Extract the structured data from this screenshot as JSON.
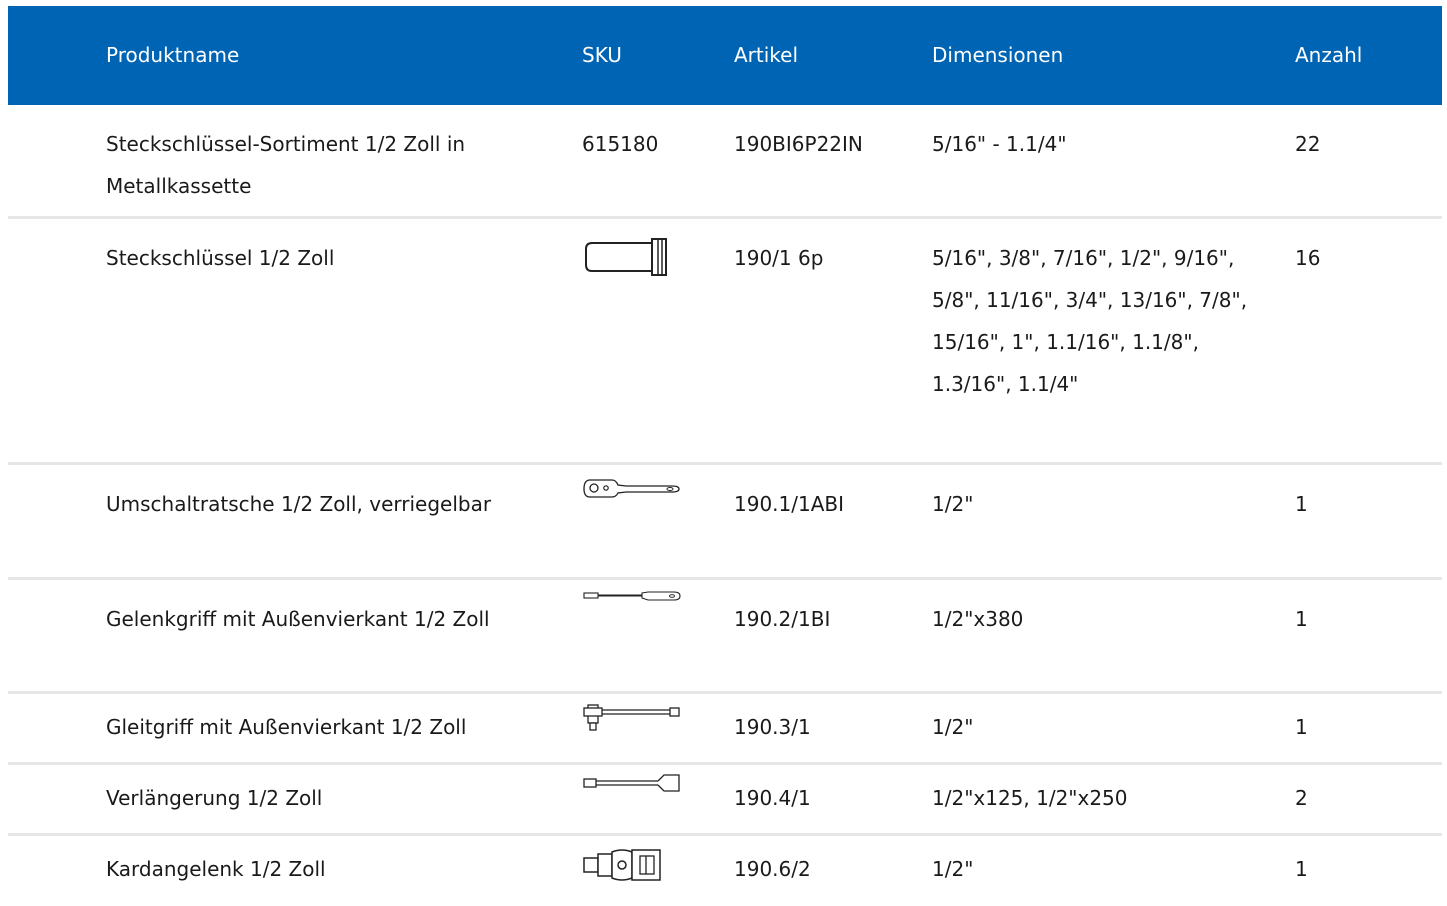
{
  "header": {
    "name": "Produktname",
    "sku": "SKU",
    "artikel": "Artikel",
    "dimensionen": "Dimensionen",
    "anzahl": "Anzahl"
  },
  "rows": [
    {
      "name": "Steckschlüssel-Sortiment 1/2 Zoll in Metallkassette",
      "sku": "615180",
      "artikel": "190BI6P22IN",
      "dimensionen": "5/16\" - 1.1/4\"",
      "anzahl": "22"
    },
    {
      "name": "Steckschlüssel 1/2 Zoll",
      "icon": "socket-icon",
      "artikel": "190/1 6p",
      "dimensionen": "5/16\", 3/8\", 7/16\", 1/2\", 9/16\", 5/8\", 11/16\", 3/4\", 13/16\", 7/8\", 15/16\", 1\", 1.1/16\", 1.1/8\", 1.3/16\", 1.1/4\"",
      "anzahl": "16"
    },
    {
      "name": "Umschaltratsche 1/2 Zoll, verriegelbar",
      "icon": "ratchet-icon",
      "artikel": "190.1/1ABI",
      "dimensionen": "1/2\"",
      "anzahl": "1"
    },
    {
      "name": "Gelenkgriff mit Außenvierkant 1/2 Zoll",
      "icon": "hinged-handle-icon",
      "artikel": "190.2/1BI",
      "dimensionen": "1/2\"x380",
      "anzahl": "1"
    },
    {
      "name": "Gleitgriff mit Außenvierkant 1/2 Zoll",
      "icon": "sliding-t-handle-icon",
      "artikel": "190.3/1",
      "dimensionen": "1/2\"",
      "anzahl": "1"
    },
    {
      "name": "Verlängerung 1/2 Zoll",
      "icon": "extension-bar-icon",
      "artikel": "190.4/1",
      "dimensionen": "1/2\"x125, 1/2\"x250",
      "anzahl": "2"
    },
    {
      "name": "Kardangelenk 1/2 Zoll",
      "icon": "universal-joint-icon",
      "artikel": "190.6/2",
      "dimensionen": "1/2\"",
      "anzahl": "1"
    }
  ]
}
